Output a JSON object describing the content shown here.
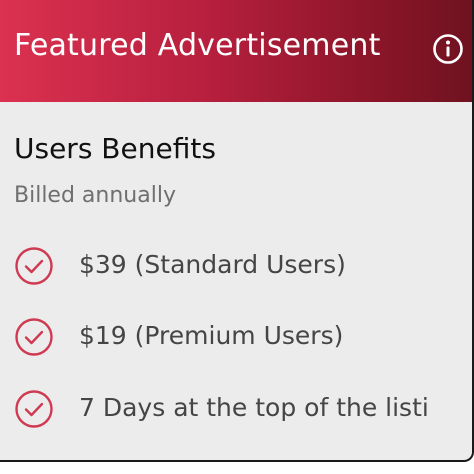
{
  "header": {
    "title": "Featured Advertisement",
    "info_icon": "info-icon"
  },
  "plan": {
    "title": "Users Benefits",
    "billing": "Billed annually"
  },
  "benefits": [
    {
      "icon": "check-circle-icon",
      "label": "$39 (Standard Users)"
    },
    {
      "icon": "check-circle-icon",
      "label": "$19 (Premium Users)"
    },
    {
      "icon": "check-circle-icon",
      "label": "7 Days at the top of the listi"
    }
  ],
  "colors": {
    "accent": "#cf3a52",
    "header_start": "#dc3150",
    "header_end": "#6e1220",
    "card_bg": "#ececec"
  }
}
